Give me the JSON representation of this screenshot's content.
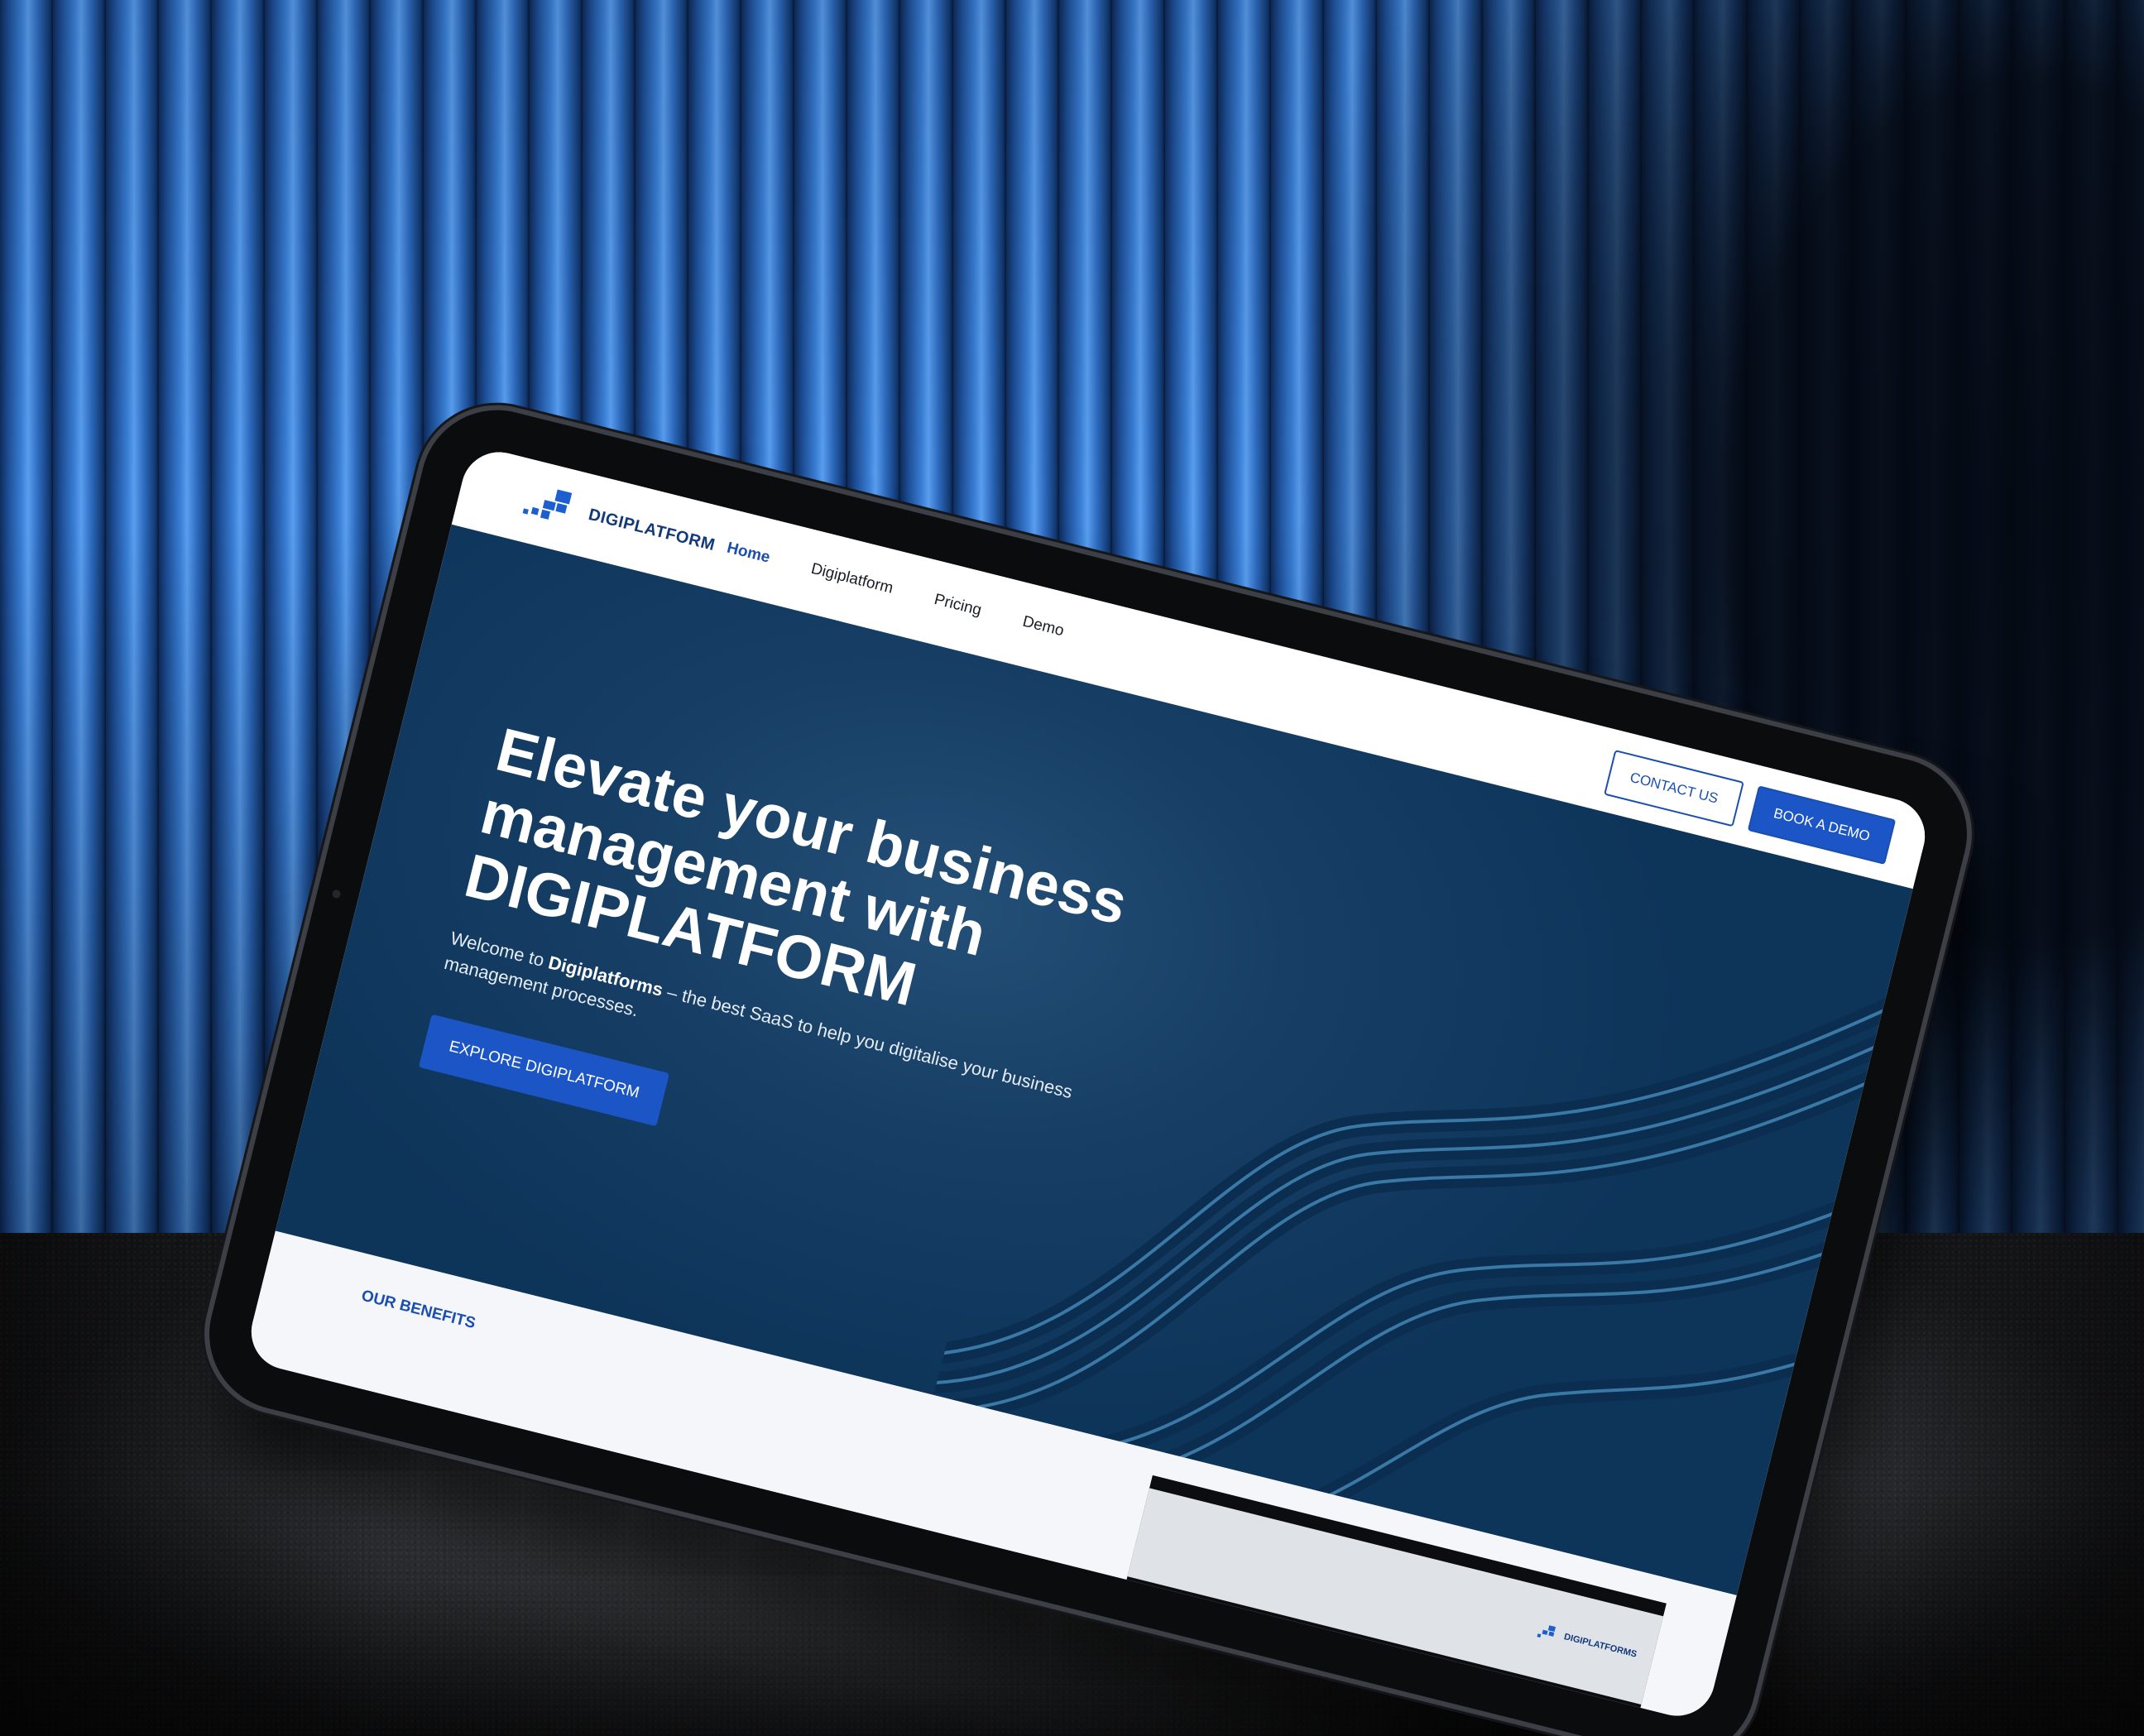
{
  "brand": {
    "logo_text": "DIGIPLATFORM",
    "accent": "#1b55c6",
    "hero_bg": "#173f66"
  },
  "nav": {
    "links": [
      "Home",
      "Digiplatform",
      "Pricing",
      "Demo"
    ],
    "active": "Home",
    "contact_label": "CONTACT US",
    "demo_label": "BOOK A DEMO"
  },
  "hero": {
    "title_line1": "Elevate your business",
    "title_line2": "management with",
    "title_line3": "DIGIPLATFORM",
    "sub_prefix": "Welcome to ",
    "sub_brand": "Digiplatforms",
    "sub_rest": " – the best SaaS to help you digitalise your business management processes.",
    "cta_label": "EXPLORE DIGIPLATFORM"
  },
  "benefits": {
    "label": "OUR BENEFITS",
    "preview_logo_text": "DIGIPLATFORMS"
  },
  "icons": {
    "logo": "digiplatform-logo-icon",
    "camera": "front-camera-icon"
  }
}
